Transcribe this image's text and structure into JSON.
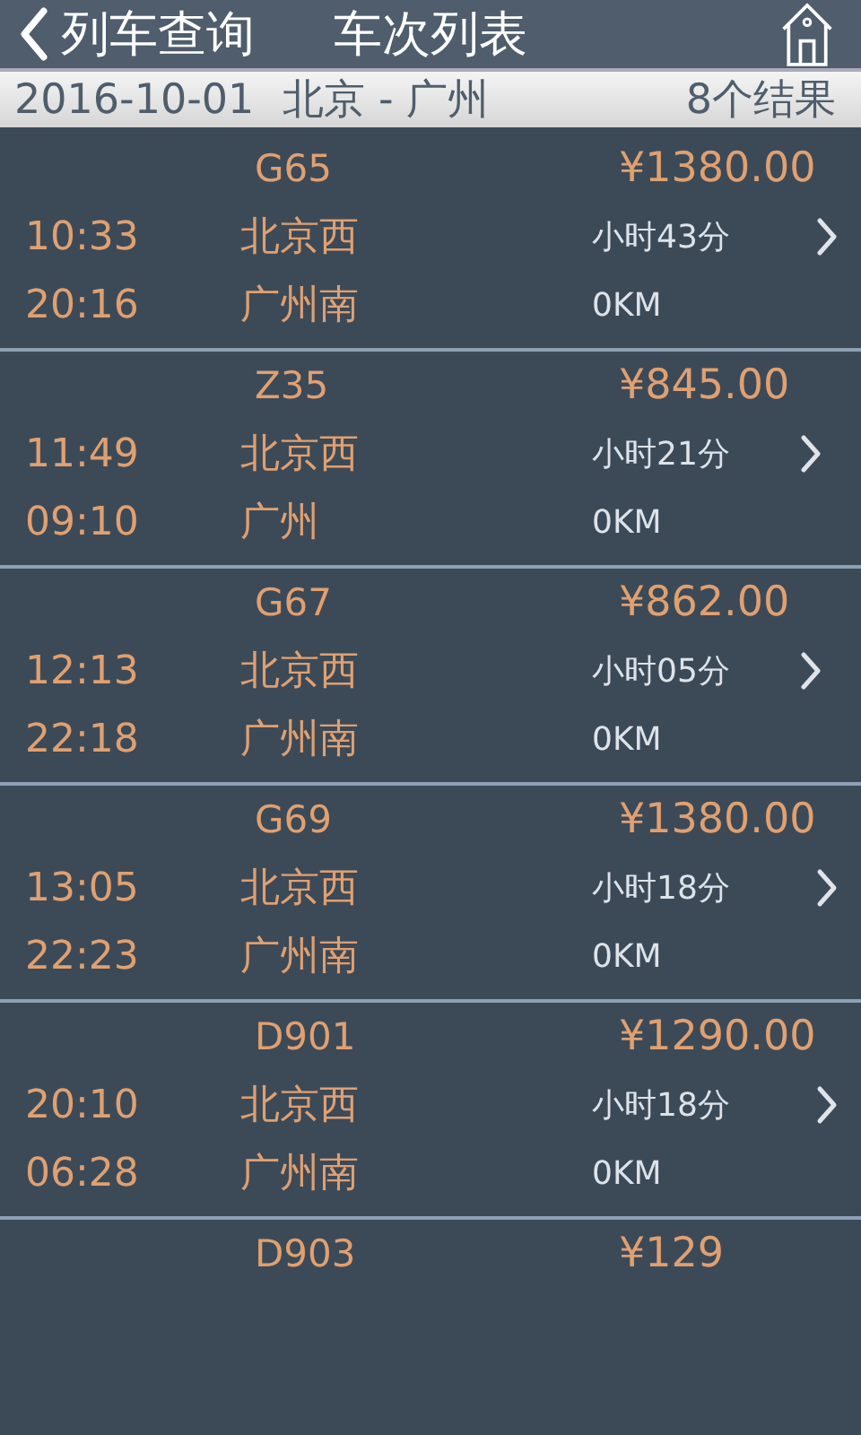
{
  "nav": {
    "back": "列车查询",
    "title": "车次列表"
  },
  "summary": {
    "date": "2016-10-01",
    "route": "北京 - 广州",
    "count": "8个结果"
  },
  "trains": [
    {
      "train": "G65",
      "price": "¥1380.00",
      "depart": "10:33",
      "from": "北京西",
      "duration": "小时43分",
      "arrive": "20:16",
      "to": "广州南",
      "distance": "0KM"
    },
    {
      "train": "Z35",
      "price": "¥845.00",
      "depart": "11:49",
      "from": "北京西",
      "duration": "小时21分",
      "arrive": "09:10",
      "to": "广州",
      "distance": "0KM"
    },
    {
      "train": "G67",
      "price": "¥862.00",
      "depart": "12:13",
      "from": "北京西",
      "duration": "小时05分",
      "arrive": "22:18",
      "to": "广州南",
      "distance": "0KM"
    },
    {
      "train": "G69",
      "price": "¥1380.00",
      "depart": "13:05",
      "from": "北京西",
      "duration": "小时18分",
      "arrive": "22:23",
      "to": "广州南",
      "distance": "0KM"
    },
    {
      "train": "D901",
      "price": "¥1290.00",
      "depart": "20:10",
      "from": "北京西",
      "duration": "小时18分",
      "arrive": "06:28",
      "to": "广州南",
      "distance": "0KM"
    },
    {
      "train": "D903",
      "price": "¥129"
    }
  ]
}
